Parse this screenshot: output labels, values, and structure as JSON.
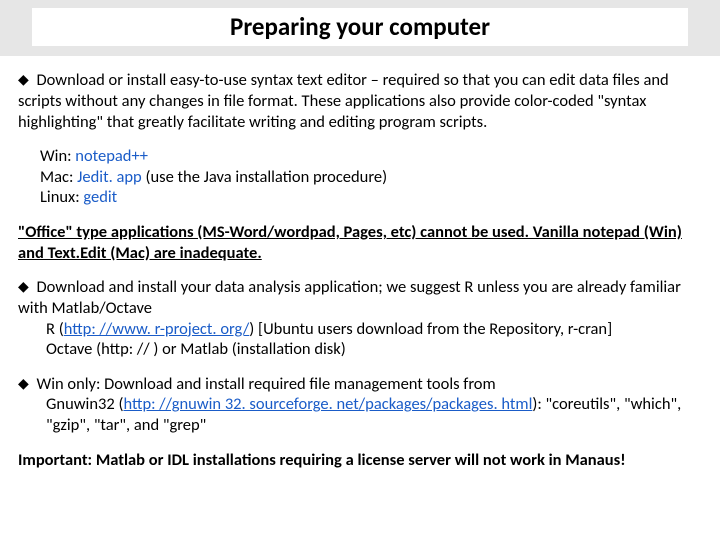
{
  "title": "Preparing your computer",
  "p1": {
    "bullet": "◆",
    "text": " Download or install easy-to-use syntax text editor – required so that you can edit data files and scripts without any changes in file format. These applications also provide color-coded \"syntax highlighting\" that greatly facilitate writing and editing program scripts."
  },
  "editors": {
    "win_label": "Win:  ",
    "win_app": "notepad++",
    "mac_label": "Mac:  ",
    "mac_app": "Jedit. app",
    "mac_note": "   (use the Java installation procedure)",
    "linux_label": "Linux: ",
    "linux_app": "gedit"
  },
  "p2": "\"Office\" type applications (MS-Word/wordpad, Pages, etc) cannot be used. Vanilla notepad (Win) and Text.Edit (Mac) are inadequate.",
  "p3": {
    "bullet": "◆",
    "lead": "   Download and install your  data analysis application; we suggest R unless you are already familiar with Matlab/Octave",
    "r_label": "R  (",
    "r_url": "http: //www. r-project. org/",
    "r_tail": ")  [Ubuntu users download from the Repository, r-cran]",
    "octave": "Octave (http: //   ) or Matlab (installation disk)"
  },
  "p4": {
    "bullet": "◆",
    "lead": " Win only: Download and install required file management tools from",
    "gnu_label": "Gnuwin32 (",
    "gnu_url": "http: //gnuwin 32. sourceforge. net/packages/packages. html",
    "gnu_tail": "):  \"coreutils\", \"which\", \"gzip\", \"tar\",  and \"grep\""
  },
  "p5": "Important: Matlab or IDL  installations requiring a license server will not work in Manaus!"
}
